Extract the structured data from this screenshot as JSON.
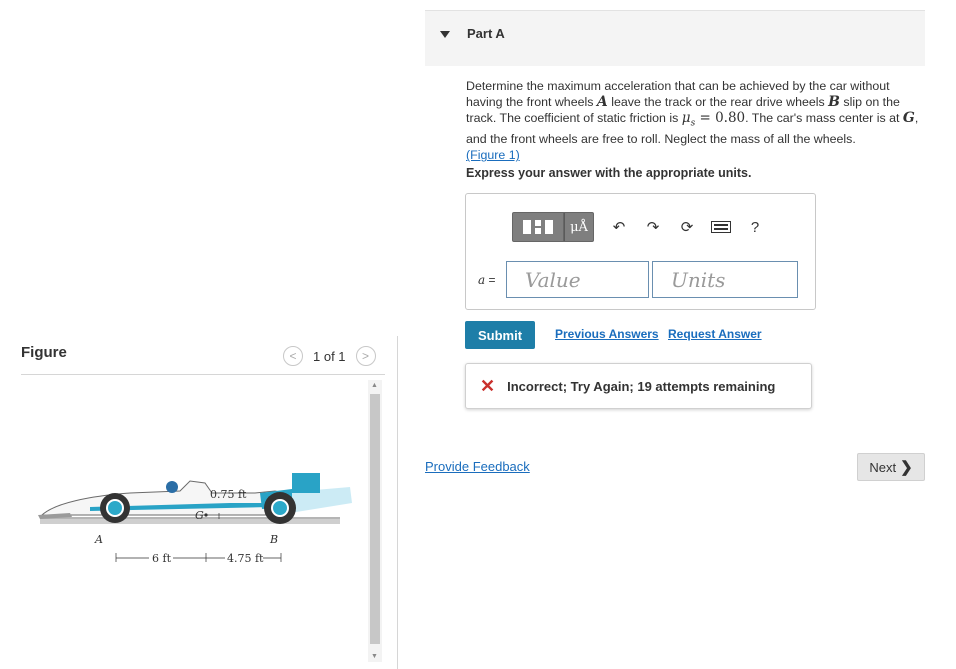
{
  "part": {
    "title": "Part A"
  },
  "question": {
    "text_1": "Determine the maximum acceleration that can be achieved by the car without having the front wheels ",
    "var_A": "A",
    "text_2": " leave the track or the rear drive wheels ",
    "var_B": "B",
    "text_3": " slip on the track. The coefficient of static friction is ",
    "mu": "μ",
    "mu_sub": "s",
    "eq": " = 0.80",
    "text_4": ". The car's mass center is at ",
    "var_G": "G",
    "text_5": ", and the front wheels are free to roll. Neglect the mass of all the wheels.",
    "figure_link": "(Figure 1)",
    "express": "Express your answer with the appropriate units."
  },
  "answer": {
    "toolbar_mu": "μÅ",
    "help": "?",
    "label_var": "a",
    "label_eq": " =",
    "value_placeholder": "Value",
    "units_placeholder": "Units"
  },
  "actions": {
    "submit": "Submit",
    "previous_answers": "Previous Answers",
    "request_answer": "Request Answer"
  },
  "feedback": {
    "icon": "✕",
    "message": "Incorrect; Try Again; 19 attempts remaining"
  },
  "footer": {
    "provide_feedback": "Provide Feedback",
    "next": "Next",
    "next_chevron": "❯"
  },
  "figure": {
    "title": "Figure",
    "pager_prev": "<",
    "pager_count": "1 of 1",
    "pager_next": ">",
    "labels": {
      "A": "A",
      "B": "B",
      "G": "G",
      "height": "0.75 ft",
      "left_dim": "6 ft",
      "right_dim": "4.75 ft"
    }
  },
  "colors": {
    "accent": "#1e7ea8",
    "link": "#1a6dbd",
    "error": "#c9302c",
    "car_blue": "#29a3c6"
  }
}
